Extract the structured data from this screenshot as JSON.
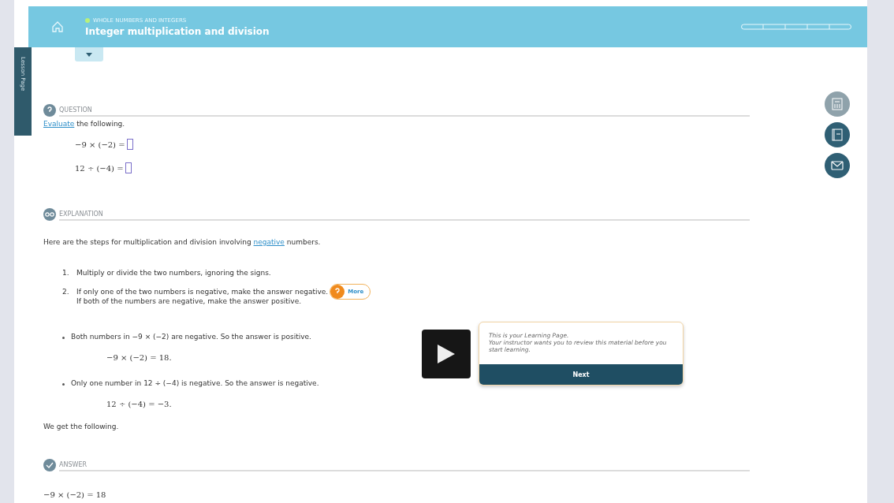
{
  "header": {
    "breadcrumb": "WHOLE NUMBERS AND INTEGERS",
    "title": "Integer multiplication and division"
  },
  "side_tab": "Lesson Page",
  "dropdown": {
    "expanded": false
  },
  "question": {
    "heading": "QUESTION",
    "prompt_link": "Evaluate",
    "prompt": "the following.",
    "equations": [
      "−9 × (−2) =",
      "12 ÷ (−4) ="
    ]
  },
  "explanation": {
    "heading": "EXPLANATION",
    "intro_before": "Here are the steps for multiplication and division involving",
    "intro_link": "negative",
    "intro_after": "numbers.",
    "steps": [
      {
        "number": "1.",
        "lines": [
          "Multiply or divide the two numbers, ignoring the signs."
        ]
      },
      {
        "number": "2.",
        "lines": [
          "If only one of the two numbers is negative, make the answer negative.",
          "If both of the numbers are negative, make the answer positive."
        ]
      }
    ],
    "more_button": "More",
    "bullets": [
      {
        "text": "Both numbers in −9 × (−2) are negative. So the answer is positive.",
        "result": "−9 × (−2) = 18."
      },
      {
        "text": "Only one number in 12 ÷ (−4) is negative. So the answer is negative.",
        "result": "12 ÷ (−4) = −3."
      }
    ],
    "conclusion": "We get the following."
  },
  "answer": {
    "heading": "ANSWER",
    "first_line": "−9 × (−2) = 18"
  },
  "tooltip": {
    "lines": [
      "This is your Learning Page.",
      "Your instructor wants you to review this material before you start learning."
    ],
    "button": "Next"
  },
  "tools": [
    {
      "kind": "calculator",
      "disabled": true
    },
    {
      "kind": "ebook",
      "disabled": false
    },
    {
      "kind": "message",
      "disabled": false
    }
  ]
}
